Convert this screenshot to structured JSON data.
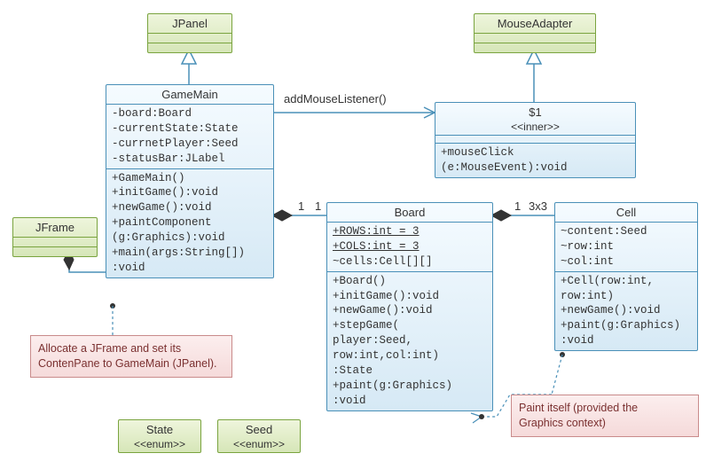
{
  "jpanel": {
    "name": "JPanel"
  },
  "gamemain": {
    "name": "GameMain",
    "fields": [
      "-board:Board",
      "-currentState:State",
      "-currnetPlayer:Seed",
      "-statusBar:JLabel"
    ],
    "methods": [
      "+GameMain()",
      "+initGame():void",
      "+newGame():void",
      "+paintComponent",
      "  (g:Graphics):void",
      "+main(args:String[])",
      "  :void"
    ]
  },
  "mouseadapter": {
    "name": "MouseAdapter"
  },
  "inner": {
    "name": "$1",
    "stereo": "<<inner>>",
    "methods": [
      "+mouseClick",
      "  (e:MouseEvent):void"
    ]
  },
  "jframe": {
    "name": "JFrame"
  },
  "board": {
    "name": "Board",
    "fields": [
      "+ROWS:int = 3",
      "+COLS:int = 3",
      "~cells:Cell[][]"
    ],
    "methods": [
      "+Board()",
      "+initGame():void",
      "+newGame():void",
      "+stepGame(",
      "  player:Seed,",
      "  row:int,col:int)",
      "  :State",
      "+paint(g:Graphics)",
      "  :void"
    ]
  },
  "cell": {
    "name": "Cell",
    "fields": [
      "~content:Seed",
      "~row:int",
      "~col:int"
    ],
    "methods": [
      "+Cell(row:int,",
      "  row:int)",
      "+newGame():void",
      "+paint(g:Graphics)",
      "  :void"
    ]
  },
  "state": {
    "name": "State",
    "stereo": "<<enum>>"
  },
  "seed": {
    "name": "Seed",
    "stereo": "<<enum>>"
  },
  "note1": {
    "l1": "Allocate a JFrame and set its",
    "l2": "ContenPane to GameMain (JPanel)."
  },
  "note2": {
    "l1": "Paint itself (provided the",
    "l2": "Graphics context)"
  },
  "labels": {
    "addMouse": "addMouseListener()",
    "one_a": "1",
    "one_b": "1",
    "one_c": "1",
    "threebythree": "3x3"
  }
}
